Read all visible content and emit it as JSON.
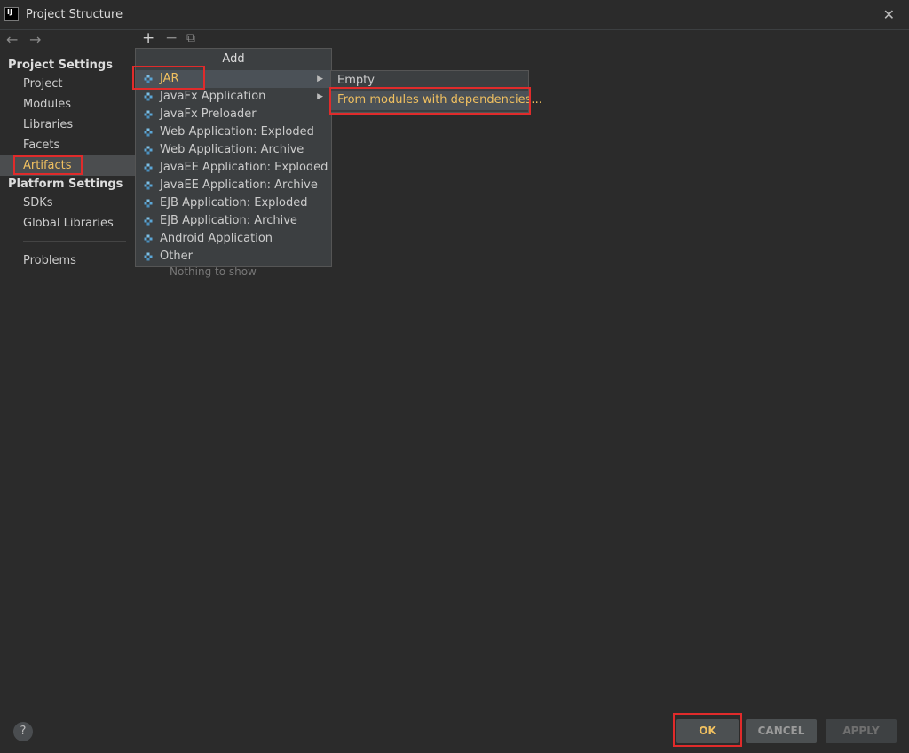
{
  "window": {
    "title": "Project Structure",
    "app_icon_text": "IJ"
  },
  "toolbar": {
    "add_symbol": "+",
    "remove_symbol": "−",
    "copy_symbol": "⧉",
    "back_symbol": "←",
    "forward_symbol": "→"
  },
  "sidebar": {
    "project_settings_header": "Project Settings",
    "project_items": [
      "Project",
      "Modules",
      "Libraries",
      "Facets",
      "Artifacts"
    ],
    "selected_item": "Artifacts",
    "platform_settings_header": "Platform Settings",
    "platform_items": [
      "SDKs",
      "Global Libraries"
    ],
    "problems": "Problems"
  },
  "add_menu": {
    "header": "Add",
    "items": [
      "JAR",
      "JavaFx Application",
      "JavaFx Preloader",
      "Web Application: Exploded",
      "Web Application: Archive",
      "JavaEE Application: Exploded",
      "JavaEE Application: Archive",
      "EJB Application: Exploded",
      "EJB Application: Archive",
      "Android Application",
      "Other"
    ],
    "selected": "JAR",
    "has_submenu": [
      "JAR",
      "JavaFx Application"
    ]
  },
  "jar_submenu": {
    "items": [
      "Empty",
      "From modules with dependencies..."
    ],
    "selected": "From modules with dependencies..."
  },
  "content": {
    "empty_text": "Nothing to show"
  },
  "footer": {
    "help_symbol": "?",
    "ok_label": "OK",
    "cancel_label": "CANCEL",
    "apply_label": "APPLY"
  },
  "colors": {
    "background": "#2b2b2b",
    "highlight_text": "#f0c060",
    "annotation_red": "#e02b2b",
    "menu_bg": "#3c3f41"
  }
}
